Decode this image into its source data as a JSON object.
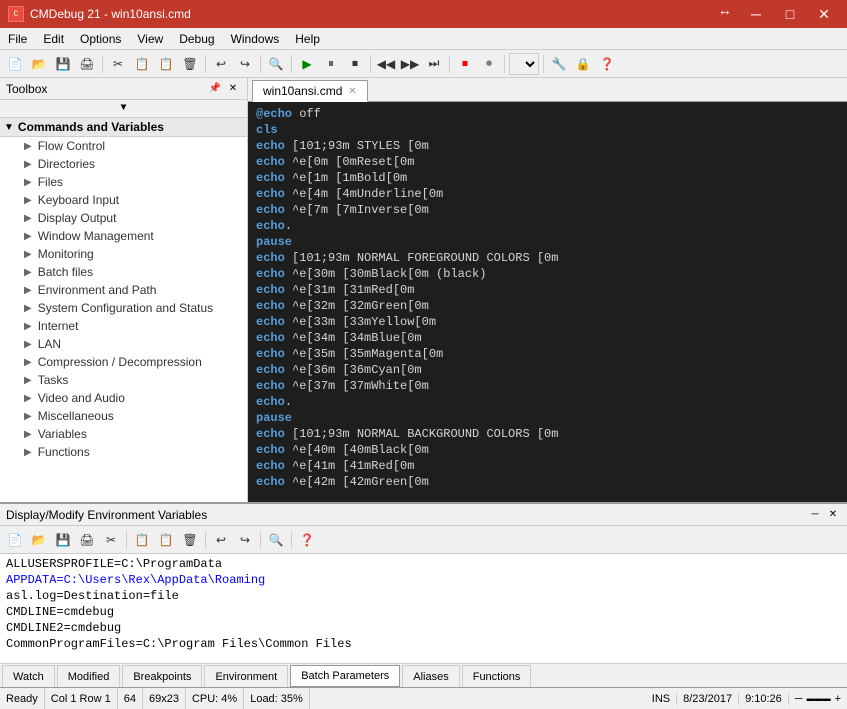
{
  "titlebar": {
    "app_icon": "C",
    "title": "CMDebug 21 - win10ansi.cmd",
    "maximize_label": "↕",
    "minimize_label": "─",
    "close_label": "✕",
    "resize_icon": "↔"
  },
  "menubar": {
    "items": [
      "File",
      "Edit",
      "Options",
      "View",
      "Debug",
      "Windows",
      "Help"
    ]
  },
  "toolbox": {
    "title": "Toolbox",
    "scroll_arrow": "▼",
    "section": {
      "label": "Commands and Variables",
      "arrow": "▼"
    },
    "items": [
      "Flow Control",
      "Directories",
      "Files",
      "Keyboard Input",
      "Display Output",
      "Window Management",
      "Monitoring",
      "Batch files",
      "Environment and Path",
      "System Configuration and Status",
      "Internet",
      "LAN",
      "Compression / Decompression",
      "Tasks",
      "Video and Audio",
      "Miscellaneous",
      "Variables",
      "Functions"
    ]
  },
  "editor_tab": {
    "filename": "win10ansi.cmd",
    "close": "✕"
  },
  "code": [
    {
      "type": "keyword",
      "text": "@echo",
      "rest": " off"
    },
    {
      "type": "keyword",
      "text": "cls",
      "rest": ""
    },
    {
      "type": "keyword",
      "text": "echo",
      "rest": " [101;93m STYLES [0m"
    },
    {
      "type": "keyword",
      "text": "echo",
      "rest": " ^e[0m [0mReset[0m"
    },
    {
      "type": "keyword",
      "text": "echo",
      "rest": " ^e[1m [1mBold[0m"
    },
    {
      "type": "keyword",
      "text": "echo",
      "rest": " ^e[4m [4mUnderline[0m"
    },
    {
      "type": "keyword",
      "text": "echo",
      "rest": " ^e[7m [7mInverse[0m"
    },
    {
      "type": "keyword",
      "text": "echo",
      "rest": "."
    },
    {
      "type": "keyword",
      "text": "pause",
      "rest": ""
    },
    {
      "type": "keyword",
      "text": "echo",
      "rest": " [101;93m NORMAL FOREGROUND COLORS [0m"
    },
    {
      "type": "keyword",
      "text": "echo",
      "rest": " ^e[30m [30mBlack[0m (black)"
    },
    {
      "type": "keyword",
      "text": "echo",
      "rest": " ^e[31m [31mRed[0m"
    },
    {
      "type": "keyword",
      "text": "echo",
      "rest": " ^e[32m [32mGreen[0m"
    },
    {
      "type": "keyword",
      "text": "echo",
      "rest": " ^e[33m [33mYellow[0m"
    },
    {
      "type": "keyword",
      "text": "echo",
      "rest": " ^e[34m [34mBlue[0m"
    },
    {
      "type": "keyword",
      "text": "echo",
      "rest": " ^e[35m [35mMagenta[0m"
    },
    {
      "type": "keyword",
      "text": "echo",
      "rest": " ^e[36m [36mCyan[0m"
    },
    {
      "type": "keyword",
      "text": "echo",
      "rest": " ^e[37m [37mWhite[0m"
    },
    {
      "type": "keyword",
      "text": "echo",
      "rest": "."
    },
    {
      "type": "keyword",
      "text": "pause",
      "rest": ""
    },
    {
      "type": "keyword",
      "text": "echo",
      "rest": " [101;93m NORMAL BACKGROUND COLORS [0m"
    },
    {
      "type": "keyword",
      "text": "echo",
      "rest": " ^e[40m [40mBlack[0m"
    },
    {
      "type": "keyword",
      "text": "echo",
      "rest": " ^e[41m [41mRed[0m"
    },
    {
      "type": "keyword",
      "text": "echo",
      "rest": " ^e[42m [42mGreen[0m"
    }
  ],
  "bottom_panel": {
    "title": "Display/Modify Environment Variables",
    "resize_icon": "─",
    "close_icon": "✕"
  },
  "env_vars": [
    {
      "text": "ALLUSERSPROFILE=C:\\ProgramData",
      "blue": false
    },
    {
      "text": "APPDATA=C:\\Users\\Rex\\AppData\\Roaming",
      "blue": true
    },
    {
      "text": "asl.log=Destination=file",
      "blue": false
    },
    {
      "text": "CMDLINE=cmdebug",
      "blue": false
    },
    {
      "text": "CMDLINE2=cmdebug",
      "blue": false
    },
    {
      "text": "CommonProgramFiles=C:\\Program Files\\Common Files",
      "blue": false
    }
  ],
  "status_tabs": [
    {
      "label": "Watch",
      "active": false
    },
    {
      "label": "Modified",
      "active": false
    },
    {
      "label": "Breakpoints",
      "active": false
    },
    {
      "label": "Environment",
      "active": false
    },
    {
      "label": "Batch Parameters",
      "active": true
    },
    {
      "label": "Aliases",
      "active": false
    },
    {
      "label": "Functions",
      "active": false
    }
  ],
  "statusbar": {
    "ready": "Ready",
    "position": "Col 1 Row 1",
    "number": "64",
    "dimensions": "69x23",
    "cpu": "CPU: 4%",
    "load": "Load: 35%",
    "ins": "INS",
    "date": "8/23/2017",
    "time": "9:10:26",
    "zoom_minus": "─",
    "zoom_slider": "─────",
    "zoom_plus": "+"
  },
  "toolbar": {
    "buttons": [
      "📄",
      "📂",
      "💾",
      "🖨️",
      "✂️",
      "📋",
      "📋",
      "🗑️",
      "↩",
      "↪",
      "🔍",
      "▶",
      "⏸",
      "⏹",
      "◀",
      "▶",
      "⏭",
      "🔴",
      "⏺"
    ],
    "play_label": "▶",
    "pause_label": "⏸",
    "stop_label": "⏹",
    "record_label": "⏺"
  }
}
